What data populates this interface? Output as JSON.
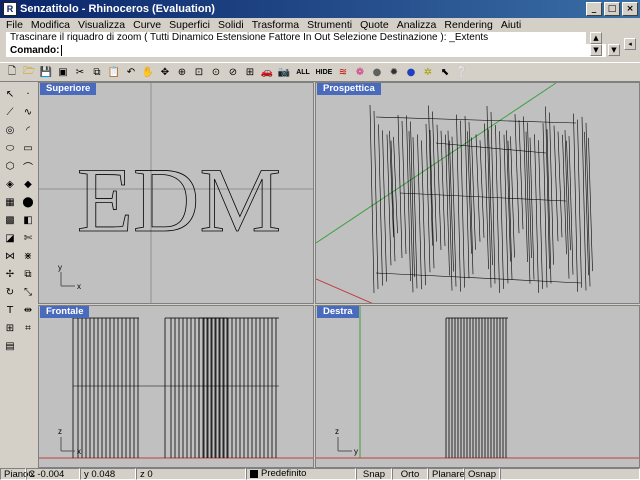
{
  "window": {
    "title": "Senzatitolo - Rhinoceros (Evaluation)",
    "controls": [
      "_",
      "□",
      "×"
    ]
  },
  "menu": [
    "File",
    "Modifica",
    "Visualizza",
    "Curve",
    "Superfici",
    "Solidi",
    "Trasforma",
    "Strumenti",
    "Quote",
    "Analizza",
    "Rendering",
    "Aiuti"
  ],
  "command": {
    "history": "Trascinare il riquadro di zoom ( Tutti  Dinamico  Estensione  Fattore  In  Out  Selezione  Destinazione ): _Extents",
    "prompt": "Comando:",
    "value": ""
  },
  "toolbar_icons": [
    "new-icon",
    "open-icon",
    "save-icon",
    "save-as-icon",
    "cut-icon",
    "copy-icon",
    "paste-icon",
    "undo-icon",
    "pan-hand-icon",
    "rotate-view-icon",
    "zoom-icon",
    "zoom-window-icon",
    "zoom-extents-icon",
    "zoom-selected-icon",
    "four-views-icon",
    "car-icon",
    "camera-icon",
    "show-all-icon",
    "hide-icon",
    "ribbon-icon",
    "color-wheel-icon",
    "sphere-shaded-icon",
    "render-icon",
    "blue-sphere-icon",
    "lightbulb-icon",
    "cursor-icon",
    "help-icon"
  ],
  "toolbar_text": {
    "show_all": "ALL",
    "hide": "HIDE"
  },
  "viewports": {
    "top": {
      "label": "Superiore",
      "text": "EDM"
    },
    "perspective": {
      "label": "Prospettica"
    },
    "front": {
      "label": "Frontale"
    },
    "right": {
      "label": "Destra"
    }
  },
  "axes": {
    "x": "x",
    "y": "y",
    "z": "z"
  },
  "status": {
    "plane": "PianoC",
    "x": "x -0.004",
    "y": "y 0.048",
    "z": "z 0",
    "layer": "Predefinito",
    "snap": "Snap",
    "orto": "Orto",
    "planare": "Planare",
    "osnap": "Osnap"
  },
  "colors": {
    "title_start": "#0a246a",
    "viewport_bg": "#c0c0c0",
    "label_bg": "#4a6bbb",
    "axis_x": "#c04040",
    "axis_y": "#40a040"
  }
}
